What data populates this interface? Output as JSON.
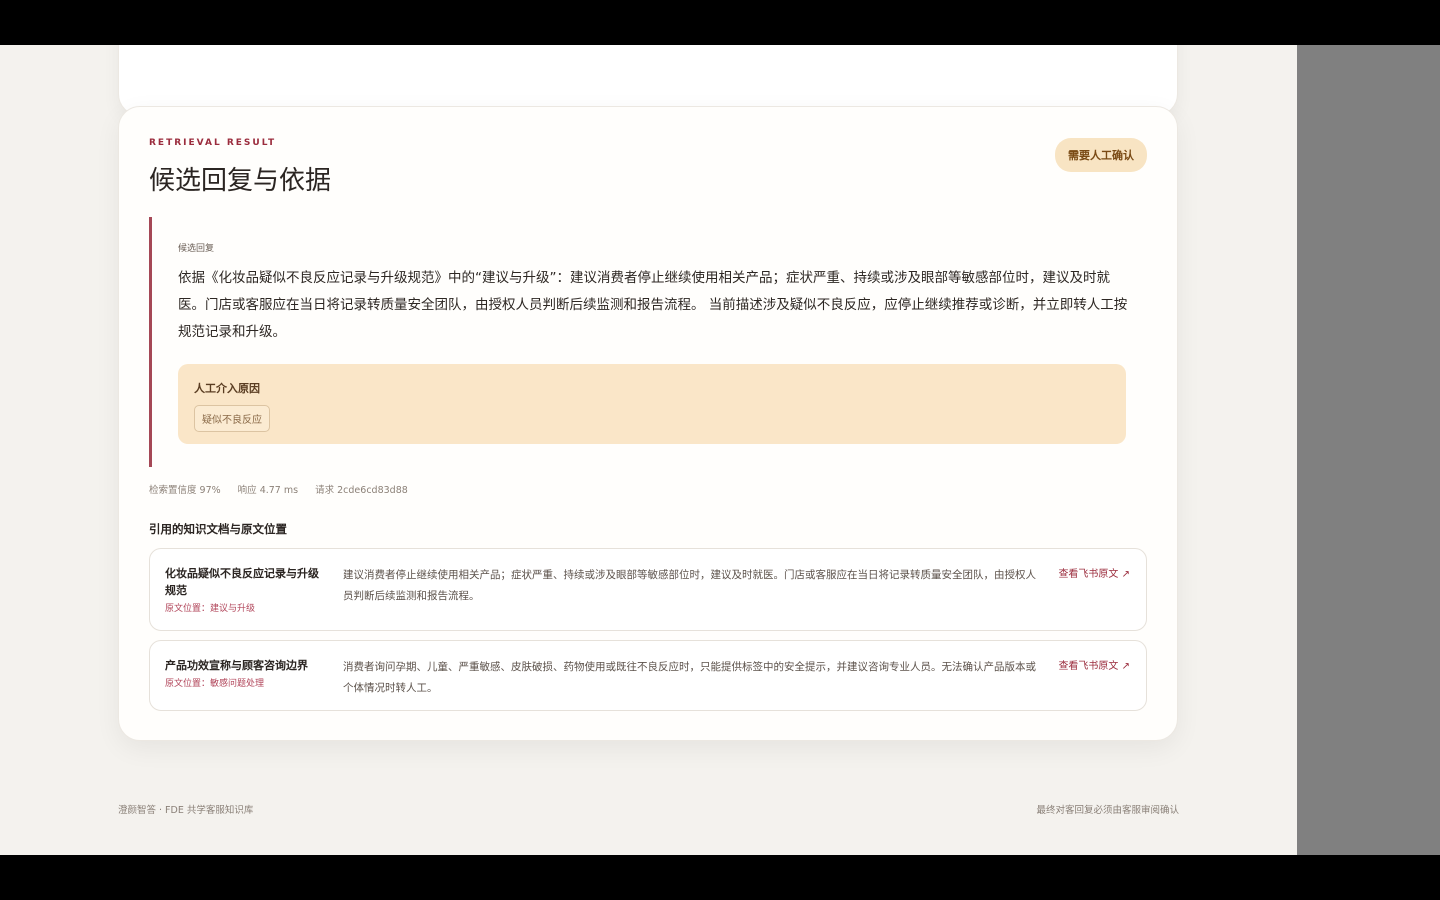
{
  "result_card": {
    "eyebrow": "RETRIEVAL RESULT",
    "title": "候选回复与依据",
    "badge": "需要人工确认",
    "answer_label": "候选回复",
    "answer_text": "依据《化妆品疑似不良反应记录与升级规范》中的“建议与升级”：建议消费者停止继续使用相关产品；症状严重、持续或涉及眼部等敏感部位时，建议及时就医。门店或客服应在当日将记录转质量安全团队，由授权人员判断后续监测和报告流程。 当前描述涉及疑似不良反应，应停止继续推荐或诊断，并立即转人工按规范记录和升级。",
    "reason_label": "人工介入原因",
    "reason_tag": "疑似不良反应",
    "meta": {
      "confidence": "检索置信度 97%",
      "latency": "响应 4.77 ms",
      "request": "请求 2cde6cd83d88"
    },
    "sources_title": "引用的知识文档与原文位置",
    "sources": [
      {
        "name": "化妆品疑似不良反应记录与升级规范",
        "location": "原文位置：建议与升级",
        "excerpt": "建议消费者停止继续使用相关产品；症状严重、持续或涉及眼部等敏感部位时，建议及时就医。门店或客服应在当日将记录转质量安全团队，由授权人员判断后续监测和报告流程。",
        "link": "查看飞书原文 ↗"
      },
      {
        "name": "产品功效宣称与顾客咨询边界",
        "location": "原文位置：敏感问题处理",
        "excerpt": "消费者询问孕期、儿童、严重敏感、皮肤破损、药物使用或既往不良反应时，只能提供标签中的安全提示，并建议咨询专业人员。无法确认产品版本或个体情况时转人工。",
        "link": "查看飞书原文 ↗"
      }
    ]
  },
  "footer": {
    "left": "澄颜智答 · FDE 共学客服知识库",
    "right": "最终对客回复必须由客服审阅确认"
  }
}
